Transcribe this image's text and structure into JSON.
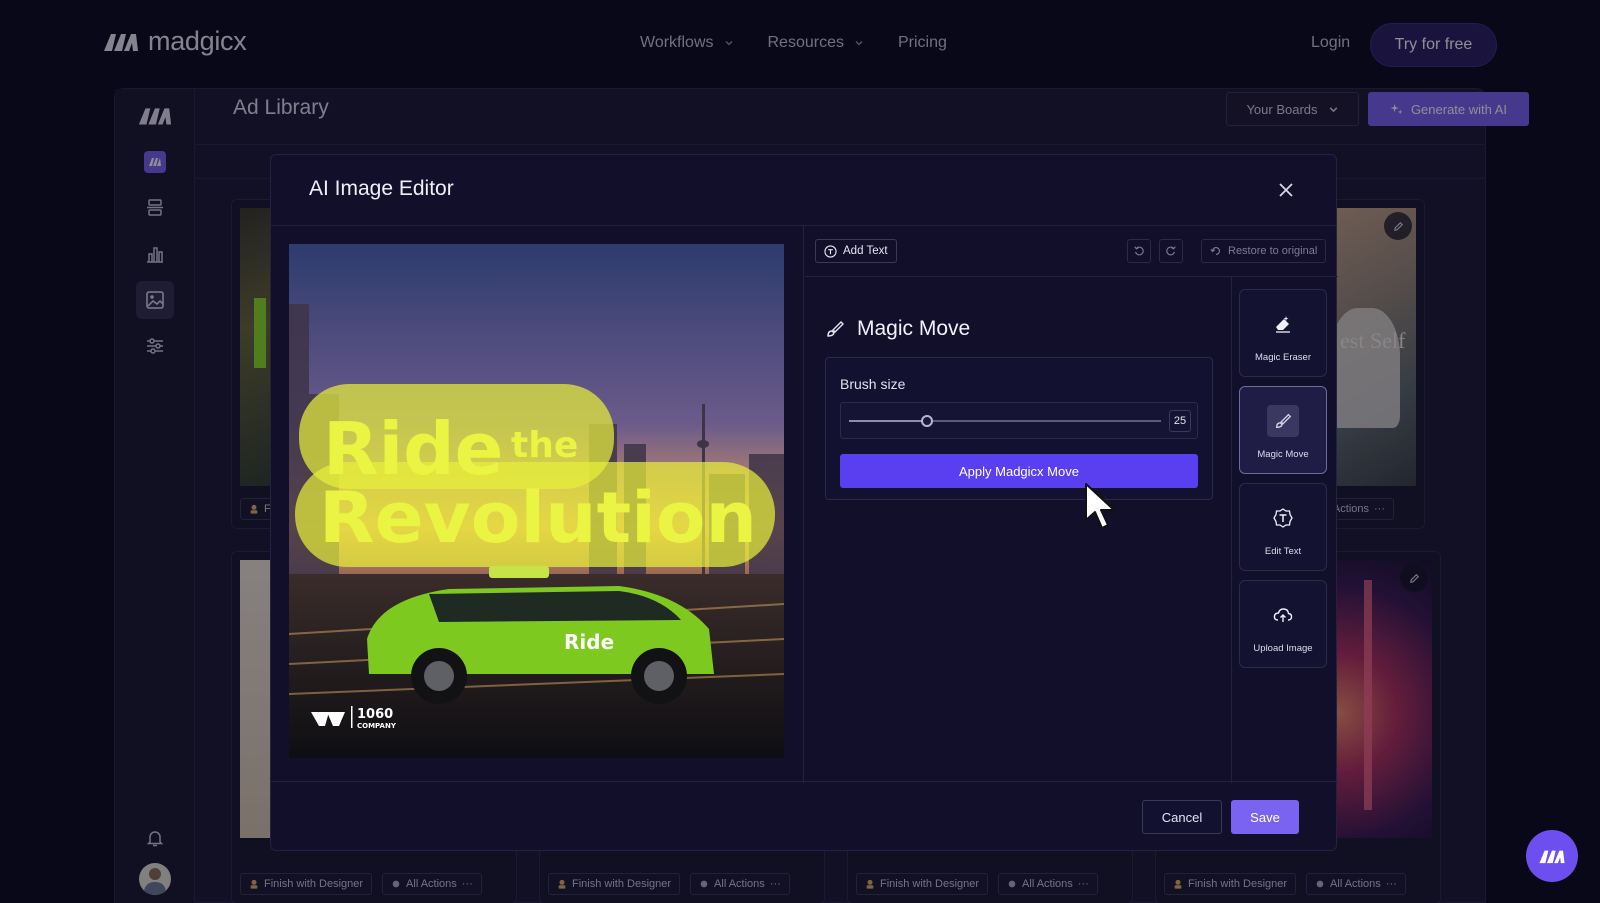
{
  "nav": {
    "brand": "madgicx",
    "links": [
      {
        "label": "Workflows",
        "has_dropdown": true
      },
      {
        "label": "Resources",
        "has_dropdown": true
      },
      {
        "label": "Pricing",
        "has_dropdown": false
      }
    ],
    "login_label": "Login",
    "cta_label": "Try for free"
  },
  "app": {
    "title": "Ad Library",
    "boards_label": "Your Boards",
    "generate_label": "Generate with AI",
    "sidebar_icons": [
      "madgicx-logo",
      "madgicx-app-icon",
      "stack-icon",
      "bar-chart-icon",
      "image-icon",
      "sliders-icon",
      "bell-icon",
      "avatar"
    ]
  },
  "cards": {
    "finish_label": "Finish with Designer",
    "actions_label": "All Actions",
    "partial_finish": "F",
    "partial_caption": "est Self"
  },
  "editor": {
    "title": "AI Image Editor",
    "add_text_label": "Add Text",
    "restore_label": "Restore to original",
    "panel_title": "Magic Move",
    "brush_label": "Brush size",
    "brush_value": "25",
    "brush_fraction": 0.25,
    "apply_label": "Apply Madgicx Move",
    "tools": [
      {
        "label": "Magic Eraser",
        "icon": "eraser-icon",
        "active": false
      },
      {
        "label": "Magic Move",
        "icon": "brush-icon",
        "active": true
      },
      {
        "label": "Edit Text",
        "icon": "edit-text-icon",
        "active": false
      },
      {
        "label": "Upload Image",
        "icon": "cloud-upload-icon",
        "active": false
      }
    ],
    "cancel_label": "Cancel",
    "save_label": "Save"
  },
  "ad": {
    "headline_1": "Ride",
    "headline_2": "the",
    "headline_3": "Revolution",
    "car_text": "Ride",
    "logo_line1": "1060",
    "logo_line2": "COMPANY"
  },
  "colors": {
    "accent": "#7b63f2",
    "apply_button": "#5a3ff0",
    "car_green": "#7ec91f",
    "headline_yellow": "#e6ef3a"
  }
}
